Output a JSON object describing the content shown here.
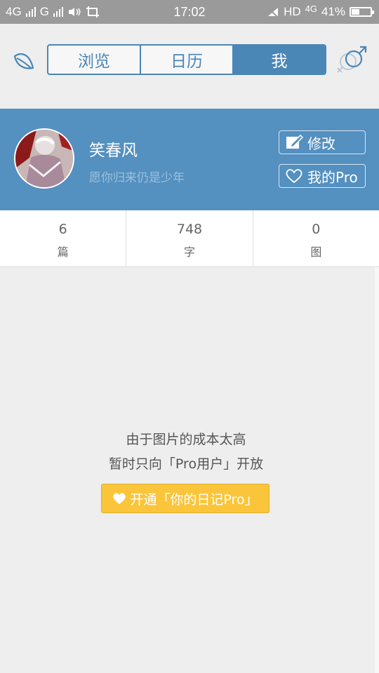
{
  "status_bar": {
    "network1": "4G",
    "network2": "G",
    "time": "17:02",
    "hd": "HD",
    "network3": "4G",
    "battery": "41%",
    "battery_level": 0.41
  },
  "tabs": [
    {
      "label": "浏览",
      "active": false
    },
    {
      "label": "日历",
      "active": false
    },
    {
      "label": "我",
      "active": true
    }
  ],
  "profile": {
    "name": "笑春风",
    "motto": "愿你归来仍是少年",
    "edit_label": "修改",
    "pro_label": "我的Pro"
  },
  "stats": [
    {
      "value": "6",
      "label": "篇"
    },
    {
      "value": "748",
      "label": "字"
    },
    {
      "value": "0",
      "label": "图"
    }
  ],
  "empty": {
    "line1": "由于图片的成本太高",
    "line2": "暂时只向「Pro用户」开放",
    "button": "开通「你的日记Pro」"
  },
  "colors": {
    "accent": "#4a86b6",
    "banner": "#5490c0",
    "pro_button": "#fac53a"
  },
  "icons": {
    "left": "leaf-icon",
    "right": "gender-icon",
    "edit": "edit-icon",
    "pro": "heart-icon"
  }
}
